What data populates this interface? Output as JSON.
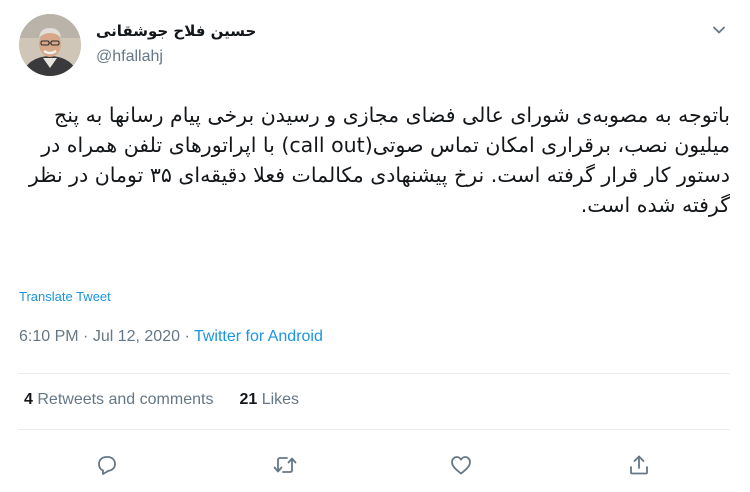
{
  "author": {
    "name": "حسین فلاح جوشقانی",
    "handle": "@hfallahj"
  },
  "tweet": {
    "text": "باتوجه به مصوبه‌ی شورای عالی فضای مجازی و رسیدن برخی پیام رسانها به پنج میلیون نصب، برقراری امکان تماس صوتی(call out) با اپراتورهای تلفن همراه در دستور کار قرار گرفته است. نرخ پیشنهادی مکالمات فعلا دقیقه‌ای ۳۵ تومان در نظر گرفته شده است."
  },
  "translate_label": "Translate Tweet",
  "meta": {
    "time": "6:10 PM",
    "separator1": " · ",
    "date": "Jul 12, 2020",
    "separator2": " · ",
    "source": "Twitter for Android"
  },
  "stats": {
    "retweets_count": "4",
    "retweets_label": "Retweets and comments",
    "likes_count": "21",
    "likes_label": "Likes"
  },
  "icons": {
    "caret": "chevron-down-icon",
    "reply": "reply-icon",
    "retweet": "retweet-icon",
    "like": "heart-icon",
    "share": "share-icon"
  },
  "colors": {
    "link": "#1b95e0",
    "secondary_text": "#657786",
    "primary_text": "#14171a",
    "divider": "#e6ecf0"
  }
}
